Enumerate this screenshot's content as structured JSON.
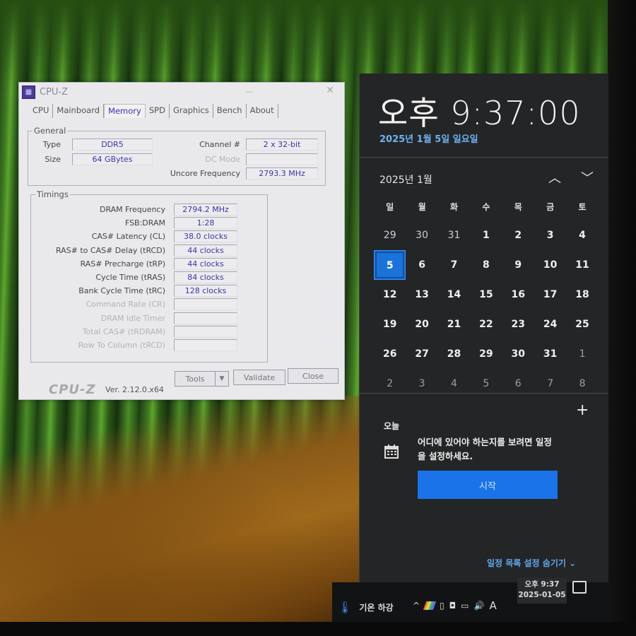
{
  "cpuz": {
    "title": "CPU-Z",
    "tabs": [
      "CPU",
      "Mainboard",
      "Memory",
      "SPD",
      "Graphics",
      "Bench",
      "About"
    ],
    "active_tab": "Memory",
    "general": {
      "label": "General",
      "type_label": "Type",
      "type_value": "DDR5",
      "size_label": "Size",
      "size_value": "64 GBytes",
      "channel_label": "Channel #",
      "channel_value": "2 x 32-bit",
      "dc_mode_label": "DC Mode",
      "dc_mode_value": "",
      "uncore_label": "Uncore Frequency",
      "uncore_value": "2793.3 MHz"
    },
    "timings": {
      "label": "Timings",
      "rows": [
        {
          "label": "DRAM Frequency",
          "value": "2794.2 MHz",
          "enabled": true
        },
        {
          "label": "FSB:DRAM",
          "value": "1:28",
          "enabled": true
        },
        {
          "label": "CAS# Latency (CL)",
          "value": "38.0 clocks",
          "enabled": true
        },
        {
          "label": "RAS# to CAS# Delay (tRCD)",
          "value": "44 clocks",
          "enabled": true
        },
        {
          "label": "RAS# Precharge (tRP)",
          "value": "44 clocks",
          "enabled": true
        },
        {
          "label": "Cycle Time (tRAS)",
          "value": "84 clocks",
          "enabled": true
        },
        {
          "label": "Bank Cycle Time (tRC)",
          "value": "128 clocks",
          "enabled": true
        },
        {
          "label": "Command Rate (CR)",
          "value": "",
          "enabled": false
        },
        {
          "label": "DRAM Idle Timer",
          "value": "",
          "enabled": false
        },
        {
          "label": "Total CAS# (tRDRAM)",
          "value": "",
          "enabled": false
        },
        {
          "label": "Row To Column (tRCD)",
          "value": "",
          "enabled": false
        }
      ]
    },
    "footer": {
      "logo": "CPU-Z",
      "version": "Ver. 2.12.0.x64",
      "tools_label": "Tools",
      "validate_label": "Validate",
      "close_label": "Close"
    }
  },
  "flyout": {
    "time": "오후 9:37:00",
    "date": "2025년 1월 5일 일요일",
    "month_title": "2025년 1월",
    "weekdays": [
      "일",
      "월",
      "화",
      "수",
      "목",
      "금",
      "토"
    ],
    "weeks": [
      [
        {
          "d": "29",
          "t": "prev"
        },
        {
          "d": "30",
          "t": "prev"
        },
        {
          "d": "31",
          "t": "prev"
        },
        {
          "d": "1",
          "t": "cur"
        },
        {
          "d": "2",
          "t": "cur"
        },
        {
          "d": "3",
          "t": "cur"
        },
        {
          "d": "4",
          "t": "cur"
        }
      ],
      [
        {
          "d": "5",
          "t": "today"
        },
        {
          "d": "6",
          "t": "cur"
        },
        {
          "d": "7",
          "t": "cur"
        },
        {
          "d": "8",
          "t": "cur"
        },
        {
          "d": "9",
          "t": "cur"
        },
        {
          "d": "10",
          "t": "cur"
        },
        {
          "d": "11",
          "t": "cur"
        }
      ],
      [
        {
          "d": "12",
          "t": "cur"
        },
        {
          "d": "13",
          "t": "cur"
        },
        {
          "d": "14",
          "t": "cur"
        },
        {
          "d": "15",
          "t": "cur"
        },
        {
          "d": "16",
          "t": "cur"
        },
        {
          "d": "17",
          "t": "cur"
        },
        {
          "d": "18",
          "t": "cur"
        }
      ],
      [
        {
          "d": "19",
          "t": "cur"
        },
        {
          "d": "20",
          "t": "cur"
        },
        {
          "d": "21",
          "t": "cur"
        },
        {
          "d": "22",
          "t": "cur"
        },
        {
          "d": "23",
          "t": "cur"
        },
        {
          "d": "24",
          "t": "cur"
        },
        {
          "d": "25",
          "t": "cur"
        }
      ],
      [
        {
          "d": "26",
          "t": "cur"
        },
        {
          "d": "27",
          "t": "cur"
        },
        {
          "d": "28",
          "t": "cur"
        },
        {
          "d": "29",
          "t": "cur"
        },
        {
          "d": "30",
          "t": "cur"
        },
        {
          "d": "31",
          "t": "cur"
        },
        {
          "d": "1",
          "t": "other"
        }
      ],
      [
        {
          "d": "2",
          "t": "other"
        },
        {
          "d": "3",
          "t": "other"
        },
        {
          "d": "4",
          "t": "other"
        },
        {
          "d": "5",
          "t": "other"
        },
        {
          "d": "6",
          "t": "other"
        },
        {
          "d": "7",
          "t": "other"
        },
        {
          "d": "8",
          "t": "other"
        }
      ]
    ],
    "today_label": "오늘",
    "agenda_message": "어디에 있어야 하는지를 보려면 일정을 설정하세요.",
    "start_button": "시작",
    "hide_agenda": "일정 목록 설정 숨기기",
    "accent": "#1a73e8"
  },
  "taskbar": {
    "weather_text": "기온 하강",
    "ime_indicator": "A",
    "clock_time": "오후 9:37",
    "clock_date": "2025-01-05"
  }
}
